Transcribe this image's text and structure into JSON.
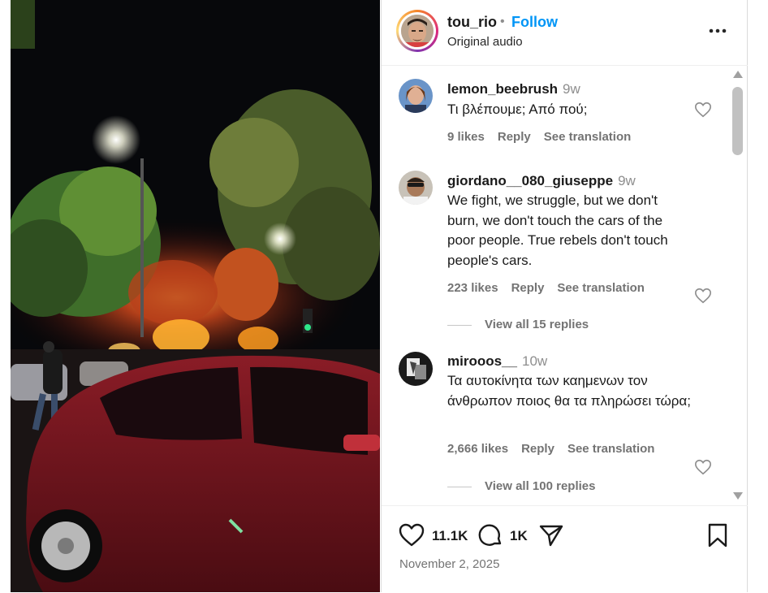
{
  "post": {
    "author": {
      "username": "tou_rio",
      "follow_label": "Follow",
      "audio_label": "Original audio",
      "separator": "•"
    },
    "actions": {
      "likes_count": "11.1K",
      "comments_count": "1K"
    },
    "date": "November 2, 2025"
  },
  "comments": [
    {
      "username": "lemon_beebrush",
      "time": "9w",
      "text": "Τι βλέπουμε; Από πού;",
      "likes": "9 likes",
      "reply_label": "Reply",
      "translate_label": "See translation"
    },
    {
      "username": "giordano__080_giuseppe",
      "time": "9w",
      "text": "We fight, we struggle, but we don't burn, we don't touch the cars of the poor people. True rebels don't touch people's cars.",
      "likes": "223 likes",
      "reply_label": "Reply",
      "translate_label": "See translation",
      "view_replies": "View all 15 replies"
    },
    {
      "username": "mirooos__",
      "time": "10w",
      "text": "Τα αυτοκίνητα των καημενων τον άνθρωπον ποιος θα τα πληρώσει τώρα;",
      "likes": "2,666 likes",
      "reply_label": "Reply",
      "translate_label": "See translation",
      "view_replies": "View all 100 replies"
    }
  ],
  "colors": {
    "follow": "#0095f6",
    "muted": "#737373",
    "text": "#1a1a1a"
  },
  "icons": {
    "more": "more-options-icon",
    "like": "heart-icon",
    "comment": "comment-bubble-icon",
    "share": "send-icon",
    "save": "bookmark-icon"
  }
}
